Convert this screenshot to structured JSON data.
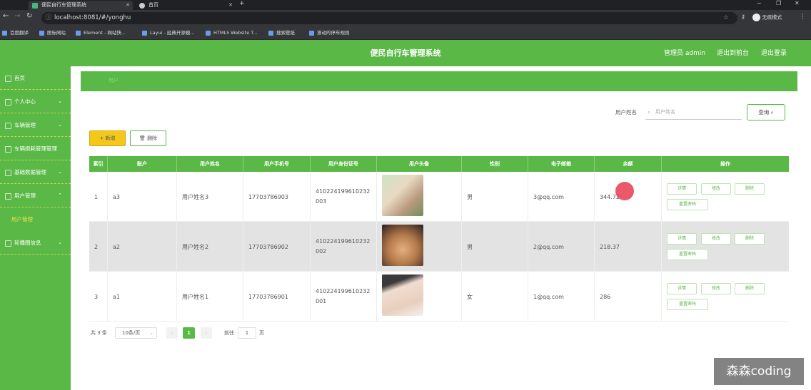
{
  "browser": {
    "tabs": [
      {
        "label": "便民自行车管理系统",
        "active": true
      },
      {
        "label": "首页",
        "active": false
      }
    ],
    "url": "localhost:8081/#/yonghu",
    "profile_label": "无痕模式",
    "bookmarks": [
      "百度翻译",
      "图标网站",
      "Element - 网站快...",
      "Layui - 经典开源模...",
      "HTML5 Website T...",
      "搜索壁纸",
      "滚动的停车规则"
    ]
  },
  "header": {
    "title": "便民自行车管理系统",
    "admin": "管理员 admin",
    "back_link": "退出到前台",
    "logout": "退出登录"
  },
  "sidebar": {
    "items": [
      {
        "label": "首页",
        "has_chevron": false
      },
      {
        "label": "个人中心",
        "has_chevron": true
      },
      {
        "label": "车辆管理",
        "has_chevron": true
      },
      {
        "label": "车辆损耗管理管理",
        "has_chevron": false
      },
      {
        "label": "基础数据管理",
        "has_chevron": true
      },
      {
        "label": "用户管理",
        "has_chevron": true,
        "expanded": true
      },
      {
        "label": "轮播图信息",
        "has_chevron": true
      }
    ],
    "subitem": "用户管理"
  },
  "breadcrumb": "用户",
  "search": {
    "label": "用户姓名",
    "placeholder": "用户姓名",
    "button": "查询"
  },
  "toolbar": {
    "add": "+ 新增",
    "delete": "删除"
  },
  "table": {
    "columns": [
      "索引",
      "账户",
      "用户姓名",
      "用户手机号",
      "用户身份证号",
      "用户头像",
      "性别",
      "电子邮箱",
      "余额",
      "操作"
    ],
    "rows": [
      {
        "index": "1",
        "account": "a3",
        "name": "用户姓名3",
        "phone": "17703786903",
        "id_card": "410224199610232003",
        "gender": "男",
        "email": "3@qq.com",
        "balance": "344.72"
      },
      {
        "index": "2",
        "account": "a2",
        "name": "用户姓名2",
        "phone": "17703786902",
        "id_card": "410224199610232002",
        "gender": "男",
        "email": "2@qq.com",
        "balance": "218.37"
      },
      {
        "index": "3",
        "account": "a1",
        "name": "用户姓名1",
        "phone": "17703786901",
        "id_card": "410224199610232001",
        "gender": "女",
        "email": "1@qq.com",
        "balance": "286"
      }
    ],
    "actions": {
      "detail": "详情",
      "edit": "修改",
      "delete": "删除",
      "reset": "重置密码"
    }
  },
  "pagination": {
    "total": "共 3 条",
    "page_size": "10条/页",
    "current": "1",
    "goto_label": "前往",
    "goto_value": "1",
    "page_unit": "页"
  },
  "watermark": "森森coding",
  "colors": {
    "primary": "#5ab846",
    "accent": "#f4c81b"
  }
}
